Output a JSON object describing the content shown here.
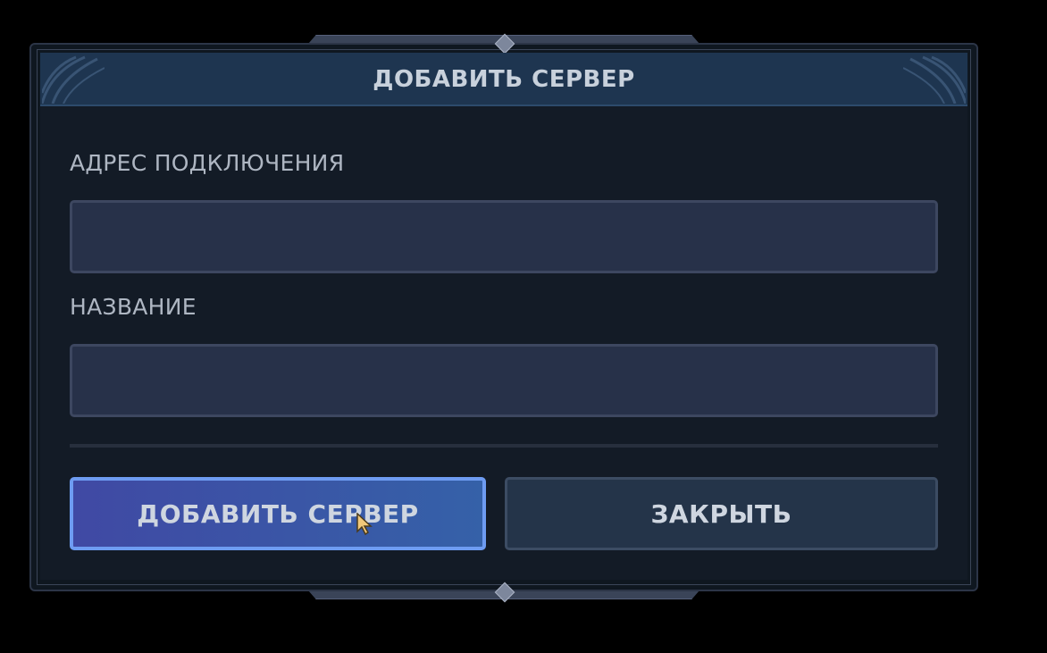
{
  "dialog": {
    "title": "ДОБАВИТЬ СЕРВЕР"
  },
  "form": {
    "address": {
      "label": "АДРЕС ПОДКЛЮЧЕНИЯ",
      "value": "",
      "placeholder": ""
    },
    "name": {
      "label": "НАЗВАНИЕ",
      "value": "",
      "placeholder": ""
    }
  },
  "actions": {
    "add_label": "ДОБАВИТЬ СЕРВЕР",
    "close_label": "ЗАКРЫТЬ"
  },
  "colors": {
    "header_bg": "#1e3550",
    "panel_bg": "#131b26",
    "input_bg": "#273149",
    "primary_border": "#6e9cf2",
    "primary_gradient_start": "#4049a4",
    "primary_gradient_end": "#3561a8",
    "secondary_bg": "#243449"
  },
  "icons": {
    "cursor": "mouse-pointer-icon",
    "frame_ornament": "celtic-knot-ornament-icon",
    "frame_gem": "diamond-gem-icon"
  }
}
